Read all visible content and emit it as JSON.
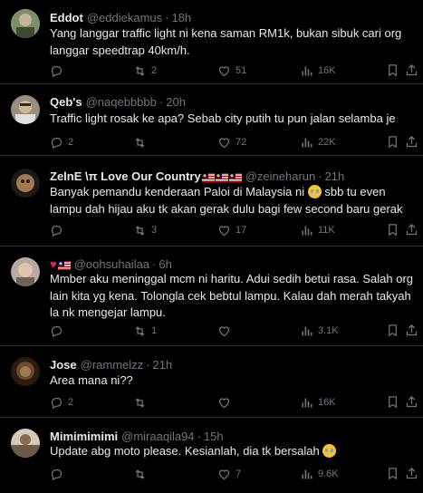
{
  "tweets": [
    {
      "name": "Eddot",
      "handle": "@eddiekamus",
      "time": "18h",
      "text": "Yang langgar traffic light ni kena saman RM1k, bukan sibuk cari org langgar speedtrap 40km/h.",
      "replies": "",
      "retweets": "2",
      "likes": "51",
      "views": "16K",
      "avatar_color": "#6f7f5a"
    },
    {
      "name": "Qeb's",
      "handle": "@naqebbbbb",
      "time": "20h",
      "text": "Traffic light rosak ke apa? Sebab city putih tu pun jalan selamba je",
      "replies": "2",
      "retweets": "",
      "likes": "72",
      "views": "22K",
      "avatar_color": "#8a7a6a"
    },
    {
      "name": "ZelnE \\π Love Our Country",
      "handle": "@zeineharun",
      "time": "21h",
      "text_a": "Banyak pemandu kenderaan Paloi di Malaysia ni ",
      "text_b": " sbb tu even lampu dah hijau aku tk akan gerak dulu bagi few second baru gerak",
      "replies": "",
      "retweets": "3",
      "likes": "17",
      "views": "11K",
      "avatar_color": "#7a5a3a"
    },
    {
      "name": "",
      "handle": "@oohsuhailaa",
      "time": "6h",
      "text": "Mmber aku meninggal mcm ni haritu. Adui sedih betui rasa. Salah org lain kita yg kena. Tolongla cek bebtul lampu. Kalau dah merah takyah la nk mengejar lampu.",
      "replies": "",
      "retweets": "1",
      "likes": "",
      "views": "3.1K",
      "avatar_color": "#9a8a80"
    },
    {
      "name": "Jose",
      "handle": "@rammelzz",
      "time": "21h",
      "text": "Area mana ni??",
      "replies": "2",
      "retweets": "",
      "likes": "",
      "views": "16K",
      "avatar_color": "#5a3a20"
    },
    {
      "name": "Mimimimimi",
      "handle": "@miraaqila94",
      "time": "15h",
      "text_a": "Update abg moto please. Kesianlah, dia tk bersalah ",
      "replies": "",
      "retweets": "",
      "likes": "7",
      "views": "9.6K",
      "avatar_color": "#b8a090"
    }
  ]
}
